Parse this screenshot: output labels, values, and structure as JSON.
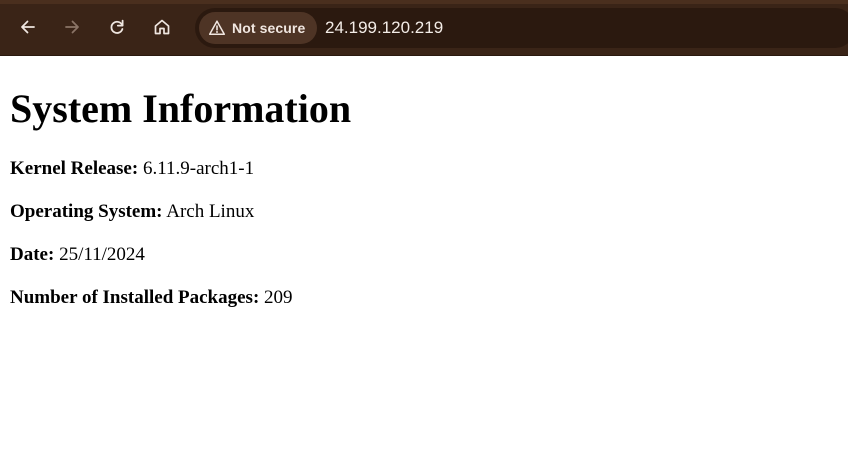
{
  "browser": {
    "security_label": "Not secure",
    "url": "24.199.120.219",
    "icons": {
      "back": "arrow-left-icon",
      "forward": "arrow-right-icon",
      "reload": "reload-icon",
      "home": "home-icon",
      "security": "warning-triangle-icon"
    },
    "colors": {
      "toolbar": "#3a2417",
      "omnibox": "#2b190f",
      "chip": "#4e3425"
    }
  },
  "page": {
    "title": "System Information",
    "rows": [
      {
        "label": "Kernel Release:",
        "value": "6.11.9-arch1-1"
      },
      {
        "label": "Operating System:",
        "value": "Arch Linux"
      },
      {
        "label": "Date:",
        "value": "25/11/2024"
      },
      {
        "label": "Number of Installed Packages:",
        "value": "209"
      }
    ]
  }
}
